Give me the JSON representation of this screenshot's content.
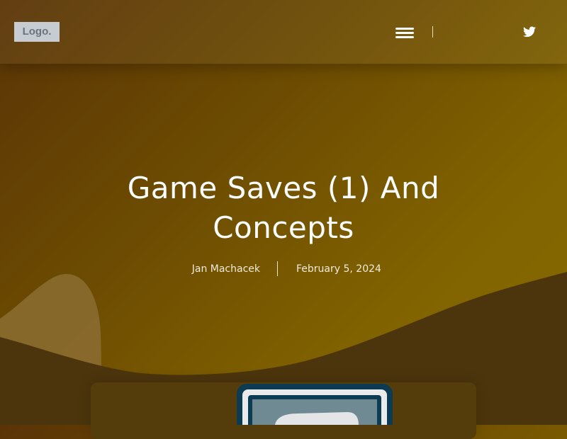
{
  "header": {
    "logo_text": "Logo.",
    "menu_icon": "hamburger-menu-icon",
    "social_icon": "twitter-icon"
  },
  "hero": {
    "title_line1": "Game Saves (1) And",
    "title_line2": "Concepts",
    "author": "Jan Machacek",
    "date": "February 5, 2024"
  },
  "colors": {
    "gradient_dark": "#5a3406",
    "gradient_light": "#8a6c00",
    "wave_dark": "#4c350c",
    "wave_accent": "#8c6d33",
    "card_bg": "#553d0b",
    "logo_bg": "#c7ccd2"
  },
  "featured_image": {
    "icon": "computer-monitor-illustration"
  }
}
